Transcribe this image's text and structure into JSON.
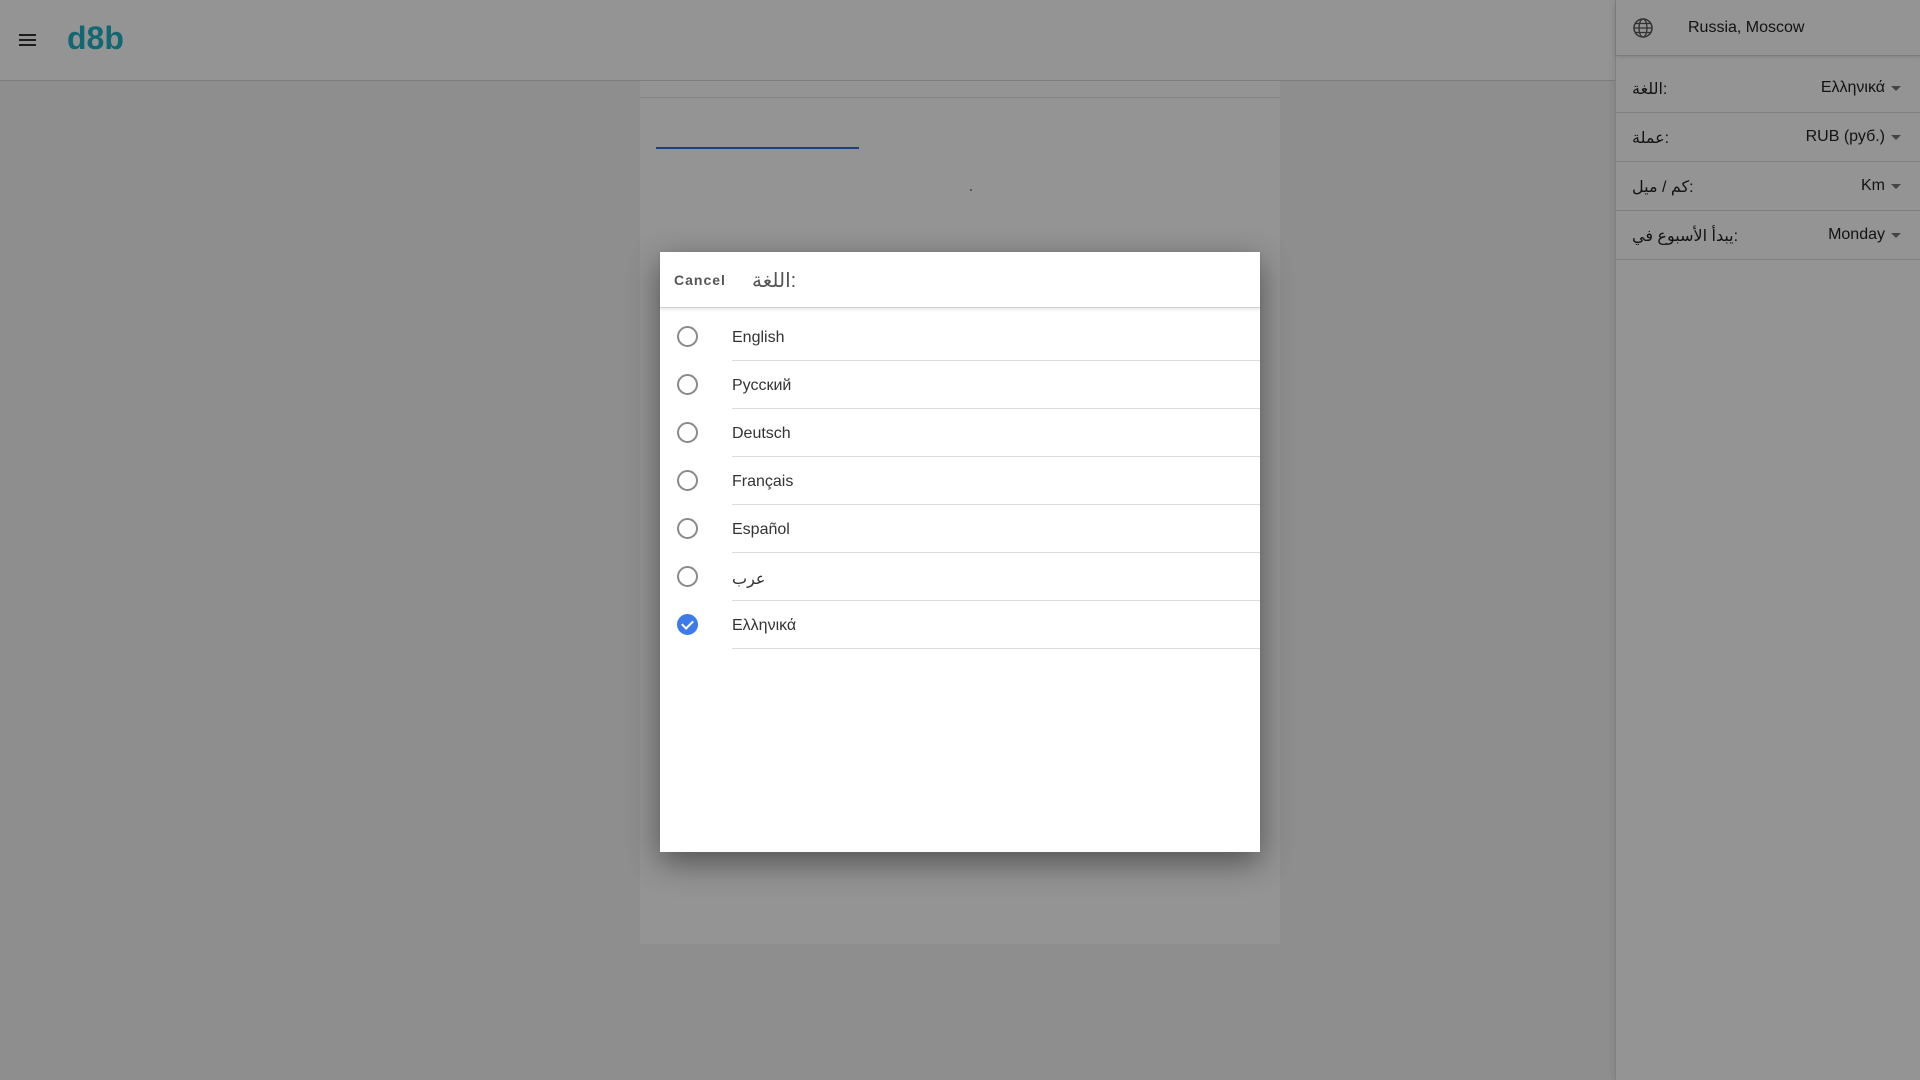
{
  "header": {
    "logo": "d8b"
  },
  "dialog": {
    "cancel_label": "Cancel",
    "title": "اللغة:",
    "options": [
      {
        "label": "English",
        "selected": false
      },
      {
        "label": "Русский",
        "selected": false
      },
      {
        "label": "Deutsch",
        "selected": false
      },
      {
        "label": "Français",
        "selected": false
      },
      {
        "label": "Español",
        "selected": false
      },
      {
        "label": "عرب",
        "selected": false
      },
      {
        "label": "Ελληνικά",
        "selected": true
      }
    ]
  },
  "side_panel": {
    "location": "Russia, Moscow",
    "settings": [
      {
        "label": "اللغة:",
        "value": "Ελληνικά"
      },
      {
        "label": "عملة:",
        "value": "RUB (руб.)"
      },
      {
        "label": "كم / ميل:",
        "value": "Km"
      },
      {
        "label": "يبدأ الأسبوع في:",
        "value": "Monday"
      }
    ]
  },
  "colors": {
    "brand": "#1fb3c5",
    "accent": "#3d7bea"
  }
}
